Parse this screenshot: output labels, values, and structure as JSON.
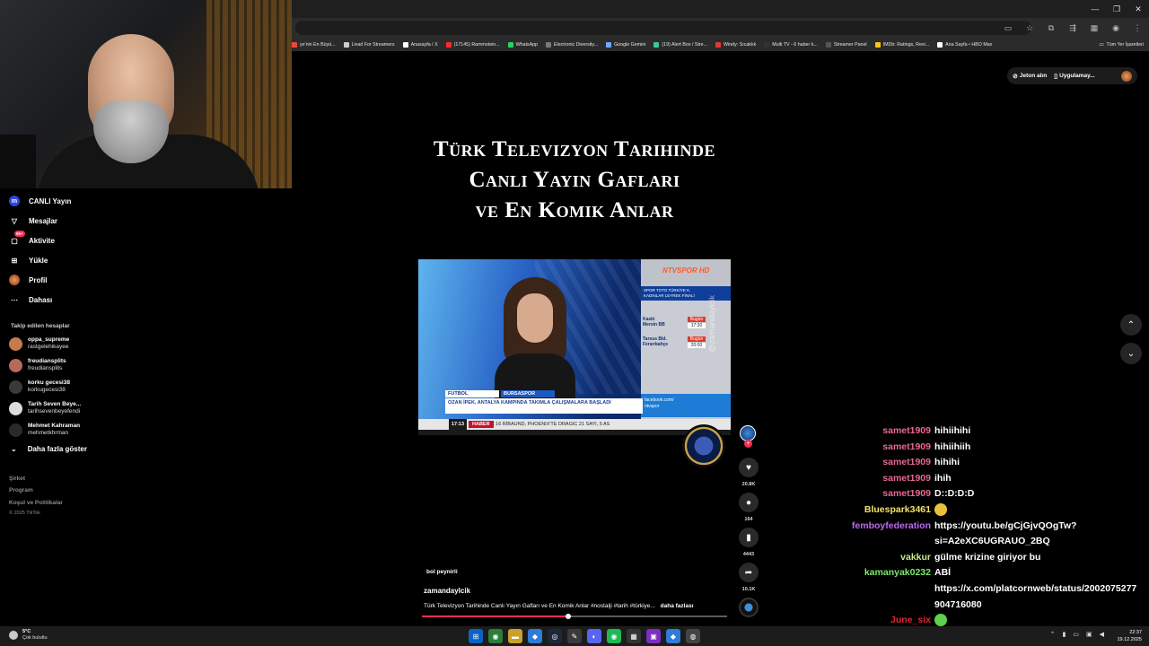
{
  "browser": {
    "bookmarks": [
      {
        "label": "ye'nin En Büyü...",
        "color": "#e84a3c"
      },
      {
        "label": "Livad For Streamers",
        "color": "#cfcfcf"
      },
      {
        "label": "Anasayfa / X",
        "color": "#ffffff"
      },
      {
        "label": "(17145) Rammstein...",
        "color": "#ff2a2a"
      },
      {
        "label": "WhatsApp",
        "color": "#25d366"
      },
      {
        "label": "Electronic Diversity...",
        "color": "#7a7a7a"
      },
      {
        "label": "Google Gemini",
        "color": "#6fa8ff"
      },
      {
        "label": "(19) Alert Box / Stre...",
        "color": "#41c4a0"
      },
      {
        "label": "Windy: Sıcaklık",
        "color": "#e03a3a"
      },
      {
        "label": "Multi TV - 6 haber k...",
        "color": "#333333"
      },
      {
        "label": "Streamer Panel",
        "color": "#555555"
      },
      {
        "label": "IMDb: Ratings, Revi...",
        "color": "#f5c518"
      },
      {
        "label": "Ana Sayfa • HBO Max",
        "color": "#ffffff"
      }
    ],
    "all_bookmarks_label": "Tüm Yer İşaretleri"
  },
  "sidebar": {
    "nav": [
      {
        "label": "CANLI Yayın",
        "icon": "live-icon"
      },
      {
        "label": "Mesajlar",
        "icon": "messages-icon"
      },
      {
        "label": "Aktivite",
        "icon": "activity-icon",
        "badge": "99+"
      },
      {
        "label": "Yükle",
        "icon": "upload-icon"
      },
      {
        "label": "Profil",
        "icon": "profile-avatar"
      },
      {
        "label": "Dahası",
        "icon": "more-icon"
      }
    ],
    "following_title": "Takip edilen hesaplar",
    "following": [
      {
        "name": "oppa_supreme",
        "user": "rastgelehikayee",
        "color": "#c77b4a"
      },
      {
        "name": "freudiansplits",
        "user": "freudiansplits",
        "color": "#b86a5a"
      },
      {
        "name": "korku gecesi38",
        "user": "korkugecesi38",
        "color": "#3a3a3a"
      },
      {
        "name": "Tarih Seven Beye...",
        "user": "tarihsevenbeyefendi",
        "color": "#dcdcdc"
      },
      {
        "name": "Mehmet Kahraman",
        "user": "mehmetkhrman",
        "color": "#2a2a2a"
      }
    ],
    "show_more": "Daha fazla göster",
    "footer_links": [
      "Şirket",
      "Program",
      "Koşul ve Politikalar"
    ],
    "copyright": "© 2025 TikTok"
  },
  "header_pills": {
    "coins": "Jeton alın",
    "app": "Uygulamay..."
  },
  "video": {
    "title_lines": [
      "Türk Televizyon Tarihinde",
      "Canlı Yayın Gafları",
      "ve En Komik Anlar"
    ],
    "tv": {
      "channel_logo": "NTVSPOR HD",
      "league_line1": "SPOR TOTO TÜRKİYE K.",
      "league_line2": "KADINLAR LEYREK FİNALİ",
      "match1_team1": "Kaski",
      "match1_team2": "Mersin BB",
      "match1_day": "Bugün",
      "match1_time": "17:30",
      "match2_team1": "Tarsus Bld.",
      "match2_team2": "Fenerbahçe",
      "match2_day": "Bugün",
      "match2_time": "20:00",
      "facebook": "facebook.com/",
      "facebook2": "ntvspor",
      "watermark": "@zamandaylcik",
      "lower_tag": "FUTBOL",
      "lower_team": "BURSASPOR",
      "lower_text": "OZAN İPEK, ANTALYA KAMPINDA TAKIMLA ÇALIŞMALARA BAŞLADI",
      "ticker_time": "17:13",
      "ticker_haber": "HABER",
      "ticker_text": "14 SAYI VE 16 RİBAUND, PHOENIX'TE DRAGIC 21 SAYI, 5 AS"
    },
    "music": "bol peynirli",
    "author": "zamandaylcik",
    "description": "Türk Televizyon Tarihinde Canlı Yayın Gafları ve En Komik Anlar #nostalji #tarih #türkiye...",
    "more_label": "daha fazlası",
    "progress": 0.48,
    "likes": "20.8K",
    "comments": "164",
    "saves": "4443",
    "shares": "10.1K"
  },
  "chat": [
    {
      "user": "samet1909",
      "color": "#e86a8e",
      "msg": "hihiihihi"
    },
    {
      "user": "samet1909",
      "color": "#e86a8e",
      "msg": "hihiihiih"
    },
    {
      "user": "samet1909",
      "color": "#e86a8e",
      "msg": "hihihi"
    },
    {
      "user": "samet1909",
      "color": "#e86a8e",
      "msg": "ihih"
    },
    {
      "user": "samet1909",
      "color": "#e86a8e",
      "msg": "D::D:D:D"
    },
    {
      "user": "Bluespark3461",
      "color": "#f5e36a",
      "msg": "",
      "emote": "#e9c23a"
    },
    {
      "user": "femboyfederation",
      "color": "#b96cf0",
      "msg": "https://youtu.be/gCjGjvQOgTw?"
    },
    {
      "user": "",
      "color": "#ffffff",
      "msg": "si=A2eXC6UGRAUO_2BQ"
    },
    {
      "user": "vakkur",
      "color": "#c7e88c",
      "msg": "gülme krizine giriyor bu"
    },
    {
      "user": "kamanyak0232",
      "color": "#7de86a",
      "msg": "ABİ"
    },
    {
      "user": "",
      "color": "#ffffff",
      "msg": "https://x.com/platcornweb/status/2002075277"
    },
    {
      "user": "",
      "color": "#ffffff",
      "msg": "904716080"
    },
    {
      "user": "June_six",
      "color": "#e0243a",
      "msg": "",
      "emote": "#5fd04a"
    }
  ],
  "chat_bottom_user": "vakkur",
  "taskbar": {
    "weather_temp": "5°C",
    "weather_desc": "Çok bulutlu",
    "time": "22:37",
    "date": "19.12.2025"
  }
}
